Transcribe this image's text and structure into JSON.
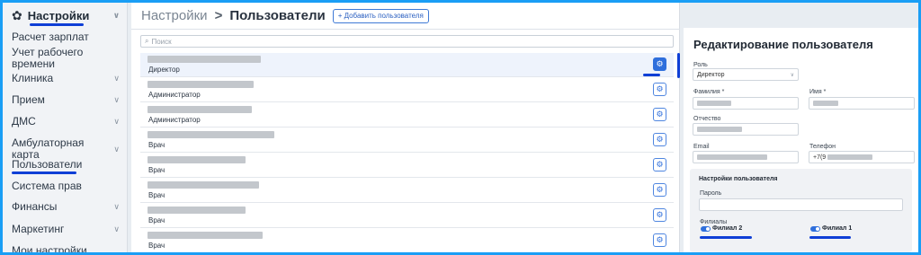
{
  "sidebar": {
    "header_label": "Настройки",
    "items": [
      {
        "label": "Расчет зарплат",
        "chevron": false
      },
      {
        "label": "Учет рабочего",
        "label2": "времени",
        "chevron": false
      },
      {
        "label": "Клиника",
        "chevron": true
      },
      {
        "label": "Прием",
        "chevron": true
      },
      {
        "label": "ДМС",
        "chevron": true
      },
      {
        "label": "Амбулаторная карта",
        "chevron": true
      },
      {
        "label": "Пользователи",
        "chevron": false
      },
      {
        "label": "Система прав",
        "chevron": false
      },
      {
        "label": "Финансы",
        "chevron": true
      },
      {
        "label": "Маркетинг",
        "chevron": true
      },
      {
        "label": "Мои настройки",
        "chevron": false
      }
    ]
  },
  "header": {
    "root": "Настройки",
    "separator": ">",
    "current": "Пользователи",
    "add_button": "+ Добавить пользователя"
  },
  "search": {
    "placeholder": "Поиск"
  },
  "users": [
    {
      "role": "Директор",
      "selected": true
    },
    {
      "role": "Администратор",
      "selected": false
    },
    {
      "role": "Администратор",
      "selected": false
    },
    {
      "role": "Врач",
      "selected": false
    },
    {
      "role": "Врач",
      "selected": false
    },
    {
      "role": "Врач",
      "selected": false
    },
    {
      "role": "Врач",
      "selected": false
    },
    {
      "role": "Врач",
      "selected": false
    }
  ],
  "edit": {
    "title": "Редактирование пользователя",
    "role_label": "Роль",
    "role_value": "Директор",
    "lastname_label": "Фамилия *",
    "firstname_label": "Имя *",
    "patronymic_label": "Отчество",
    "email_label": "Email",
    "phone_label": "Телефон",
    "phone_value": "+7(9",
    "settings_title": "Настройки пользователя",
    "password_label": "Пароль",
    "branches_label": "Филиалы",
    "branch1": "Филиал 2",
    "branch2": "Филиал 1"
  },
  "colors": {
    "accent": "#2f6fdc",
    "highlight": "#0f3fd6",
    "frame": "#1a9ef5"
  },
  "icons": {
    "settings": "gear-icon",
    "search": "search-icon",
    "expand": "chevron-down-icon",
    "user_settings": "gear-icon"
  }
}
